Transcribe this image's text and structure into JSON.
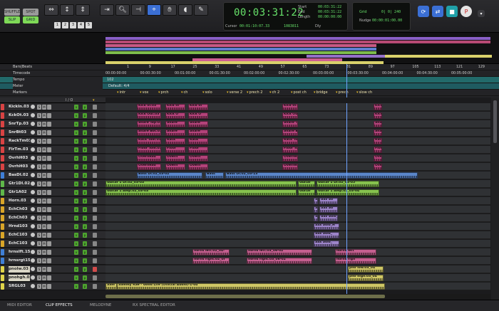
{
  "toolbar": {
    "modes": [
      "SHUFFLE",
      "SPOT",
      "SLIP",
      "GRID"
    ],
    "active_modes": [
      "SLIP",
      "GRID"
    ],
    "num_keys": [
      "1",
      "2",
      "3",
      "4",
      "5"
    ],
    "tools": [
      "zoom-tool",
      "trim-tool",
      "selector-tool",
      "grabber-tool",
      "scrubber-tool",
      "pencil-tool"
    ],
    "selected_tool": "selector-tool"
  },
  "counter": {
    "main_time": "00:03:31:22",
    "start_label": "Start",
    "end_label": "End",
    "length_label": "Length",
    "start": "00:03:31:22",
    "end": "00:03:31:22",
    "length": "00:00:00:00",
    "cursor_label": "Cursor",
    "cursor": "00:01:10:07.33",
    "samples": "1083811",
    "dly_label": "Dly"
  },
  "grid": {
    "grid_label": "Grid",
    "grid_value": "0| 0| 240",
    "nudge_label": "Nudge",
    "nudge_value": "00:00:01:00.00"
  },
  "rulers": {
    "labels": [
      "Bars|Beats",
      "Timecode",
      "Tempo",
      "Meter",
      "Markers"
    ],
    "bars": [
      "1",
      "9",
      "17",
      "25",
      "33",
      "41",
      "49",
      "57",
      "65",
      "73",
      "81",
      "89",
      "97",
      "105",
      "113",
      "121",
      "129",
      "137"
    ],
    "timecodes": [
      "00:00:00:00",
      "00:00:30:00",
      "00:01:00:00",
      "00:01:30:00",
      "00:02:00:00",
      "00:02:30:00",
      "00:03:00:00",
      "00:03:30:00",
      "00:04:00:00",
      "00:04:30:00",
      "00:05:00:00"
    ],
    "tempo": "102",
    "meter": "Default: 4/4",
    "markers": [
      "intr",
      "vox",
      "prch",
      "ch",
      "solo",
      "verse 2",
      "prech 2",
      "ch 2",
      "post ch",
      "bridge",
      "prech",
      "slow ch"
    ]
  },
  "track_header": {
    "io_label": "I / O"
  },
  "tracks": [
    {
      "name": "KickIn.03",
      "color": "#d94343",
      "clips": [
        "Kick In.03",
        "Kick In",
        "Kick In",
        "Kick In.03",
        "Kick In.0"
      ],
      "clip_color": "#b3437a"
    },
    {
      "name": "KckOt.03",
      "color": "#d94343",
      "clips": [
        "Kick Out.03",
        "Kick O",
        "Kick O",
        "Kick Out.",
        "Kick Out"
      ],
      "clip_color": "#b3437a"
    },
    {
      "name": "SnrTp.03",
      "color": "#d94343",
      "clips": [
        "Snare Top.03",
        "Snare",
        "Snare",
        "Snare To",
        "Snare To"
      ],
      "clip_color": "#b3437a"
    },
    {
      "name": "SnrBt03",
      "color": "#d94343",
      "clips": [
        "Snare Bot.03",
        "Snare",
        "Snare",
        "Snare Bo",
        "Snare Bo"
      ],
      "clip_color": "#b3437a"
    },
    {
      "name": "RackTm03",
      "color": "#d94343",
      "clips": [
        "Rack Tom.03",
        "Rack",
        "Rack",
        "Rack To",
        "Rack To"
      ],
      "clip_color": "#b3437a"
    },
    {
      "name": "FlrTm.03",
      "color": "#d94343",
      "clips": [
        "Floor Tom.03",
        "Floor",
        "Floor",
        "Floor To",
        "Floor To"
      ],
      "clip_color": "#b3437a"
    },
    {
      "name": "OvrhH03",
      "color": "#d94343",
      "clips": [
        "Overhead",
        "Overh",
        "Overh",
        "Overhead",
        "Overhea"
      ],
      "clip_color": "#b3437a"
    },
    {
      "name": "OvrhH03",
      "color": "#d94343",
      "clips": [
        "Overhead",
        "Overh",
        "Overh",
        "Overhead",
        "Overhea"
      ],
      "clip_color": "#b3437a"
    },
    {
      "name": "BasDI.02",
      "color": "#3f7fd6",
      "clips": [
        "Bass DI.02_03-02",
        "Bass",
        "Bass DI.02_03-13"
      ],
      "clip_color": "#5b86c9"
    },
    {
      "name": "Gtr1DI.02",
      "color": "#5fb84a",
      "clips": [
        "Guitar 1 DI.02_03-03",
        "Guitar",
        "Guitar 1 DI.02_03-05"
      ],
      "clip_color": "#86c24e"
    },
    {
      "name": "Gtr1A02",
      "color": "#5fb84a",
      "clips": [
        "Guitar 1 Amp.02_03-03",
        "Guitar",
        "Guitar 1 Amp.02_03-04"
      ],
      "clip_color": "#86c24e"
    },
    {
      "name": "Horn.03",
      "color": "#d9a528",
      "clips": [
        "S",
        "Sax So"
      ],
      "clip_color": "#9c84c9"
    },
    {
      "name": "EchCh03",
      "color": "#d9a528",
      "clips": [
        "S",
        "Sax So"
      ],
      "clip_color": "#9c84c9"
    },
    {
      "name": "EchCh03",
      "color": "#d9a528",
      "clips": [
        "S",
        "Sax Solo_"
      ],
      "clip_color": "#9c84c9"
    },
    {
      "name": "Hrnd103",
      "color": "#d9a528",
      "clips": [
        "Sax Solo_H"
      ],
      "clip_color": "#9c84c9"
    },
    {
      "name": "EchC103",
      "color": "#d9a528",
      "clips": [
        "Sax Solo_"
      ],
      "clip_color": "#9c84c9"
    },
    {
      "name": "EchC103",
      "color": "#d9a528",
      "clips": [
        "Sax Solo_"
      ],
      "clip_color": "#9c84c9"
    },
    {
      "name": "hrnslft.15",
      "color": "#3f7fd6",
      "clips": [
        "horns left.02_04-",
        "horns left.03_06-02",
        "horns left"
      ],
      "clip_color": "#c45f8f"
    },
    {
      "name": "hrnsrgt15",
      "color": "#3f7fd6",
      "clips": [
        "horns right.02_0r",
        "horns right.03_06-02",
        "horns righ"
      ],
      "clip_color": "#c45f8f"
    },
    {
      "name": "pnolw.03",
      "color": "#e0d44a",
      "clips": [
        "pno low.03_04"
      ],
      "clip_color": "#cfc766"
    },
    {
      "name": "pnohgh.03",
      "color": "#e0d44a",
      "clips": [
        "pno high.03_04"
      ],
      "clip_color": "#cfc766"
    },
    {
      "name": "SRGL03",
      "color": "#e0d44a",
      "clips": [
        "Sam",
        "Sammy Rae - Good Life (Official Audio)-1-04"
      ],
      "clip_color": "#cfc766"
    }
  ],
  "bottom_tabs": [
    "MIDI EDITOR",
    "CLIP EFFECTS",
    "MELODYNE",
    "RX SPECTRAL EDITOR"
  ],
  "active_bottom_tab": "CLIP EFFECTS"
}
